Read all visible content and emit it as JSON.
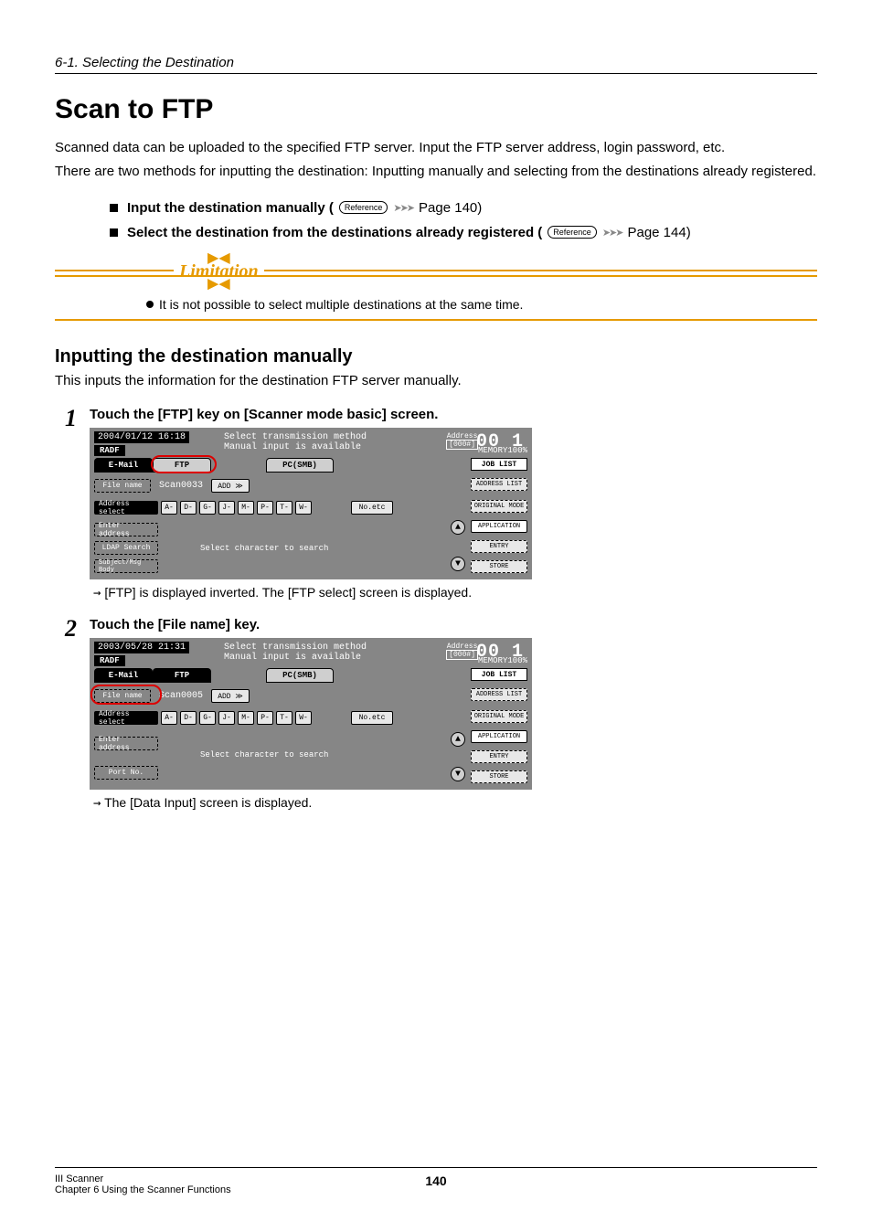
{
  "breadcrumb": "6-1. Selecting the Destination",
  "title": "Scan to FTP",
  "intro_p1": "Scanned data can be uploaded to the specified FTP server. Input the FTP server address, login password, etc.",
  "intro_p2": "There are two methods for inputting the destination:  Inputting manually and selecting from the destinations already registered.",
  "bullet1": {
    "text": "Input the destination manually (",
    "ref": "Reference",
    "page": " Page 140)"
  },
  "bullet2": {
    "text": "Select the destination from the destinations already registered (",
    "ref": "Reference",
    "page": " Page 144)"
  },
  "limitation": {
    "heading": "Limitation",
    "note": "It is not possible to select multiple destinations at the same time."
  },
  "section_heading": "Inputting the destination manually",
  "section_sub": "This inputs the information for the destination FTP server manually.",
  "steps": [
    {
      "num": "1",
      "title": "Touch the [FTP] key on [Scanner mode basic] screen.",
      "result_arrow": "→",
      "result": " [FTP] is displayed inverted.  The [FTP select] screen is displayed.",
      "lcd": {
        "datetime": "2004/01/12 16:18",
        "msg1": "Select transmission method",
        "msg2": "Manual input is available",
        "addr_label": "Address",
        "addr_count": "[000#]",
        "counter": "00 1",
        "radf": "RADF",
        "mem": "MEMORY100%",
        "tabs": {
          "email": "E-Mail",
          "ftp": "FTP",
          "pcsmb": "PC(SMB)"
        },
        "joblist": "JOB LIST",
        "filename_label": "File name",
        "filename_value": "Scan0033",
        "add": "ADD ≫",
        "address_select": "Address select",
        "letters": [
          "A-",
          "D-",
          "G-",
          "J-",
          "M-",
          "P-",
          "T-",
          "W-"
        ],
        "noetc": "No.etc",
        "enter_address": "Enter address",
        "ldap": "LDAP Search",
        "search_prompt": "Select character to search",
        "subject": "Subject/Msg Body",
        "rhs": [
          "ADDRESS LIST",
          "ORIGINAL MODE",
          "APPLICATION",
          "ENTRY",
          "STORE"
        ],
        "highlight": "ftp-tab"
      }
    },
    {
      "num": "2",
      "title": "Touch the [File name] key.",
      "result_arrow": "→",
      "result": " The [Data Input] screen is displayed.",
      "lcd": {
        "datetime": "2003/05/28 21:31",
        "msg1": "Select transmission method",
        "msg2": "Manual input is available",
        "addr_label": "Address",
        "addr_count": "[000#]",
        "counter": "00 1",
        "radf": "RADF",
        "mem": "MEMORY100%",
        "tabs": {
          "email": "E-Mail",
          "ftp": "FTP",
          "pcsmb": "PC(SMB)"
        },
        "joblist": "JOB LIST",
        "filename_label": "File name",
        "filename_value": "Scan0005",
        "add": "ADD ≫",
        "address_select": "Address select",
        "letters": [
          "A-",
          "D-",
          "G-",
          "J-",
          "M-",
          "P-",
          "T-",
          "W-"
        ],
        "noetc": "No.etc",
        "enter_address": "Enter address",
        "port": "Port No.",
        "search_prompt": "Select character to search",
        "rhs": [
          "ADDRESS LIST",
          "ORIGINAL MODE",
          "APPLICATION",
          "ENTRY",
          "STORE"
        ],
        "highlight": "file-name"
      }
    }
  ],
  "footer": {
    "left1": "III Scanner",
    "left2": "Chapter 6 Using the Scanner Functions",
    "page": "140"
  }
}
